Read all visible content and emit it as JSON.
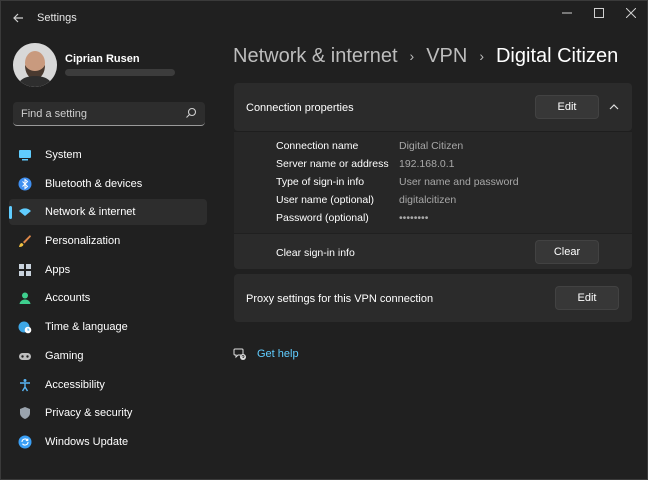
{
  "window": {
    "title": "Settings",
    "controls": [
      "minimize",
      "maximize",
      "close"
    ]
  },
  "profile": {
    "name": "Ciprian Rusen"
  },
  "search": {
    "placeholder": "Find a setting"
  },
  "sidebar": {
    "items": [
      {
        "label": "System",
        "icon": "system-icon",
        "color": "#60cdff"
      },
      {
        "label": "Bluetooth & devices",
        "icon": "bluetooth-icon",
        "color": "#3f8ff0"
      },
      {
        "label": "Network & internet",
        "icon": "wifi-icon",
        "color": "#60cdff",
        "active": true
      },
      {
        "label": "Personalization",
        "icon": "brush-icon",
        "color": "#e0894a"
      },
      {
        "label": "Apps",
        "icon": "apps-icon",
        "color": "#c9d3dd"
      },
      {
        "label": "Accounts",
        "icon": "accounts-icon",
        "color": "#3ecf8e"
      },
      {
        "label": "Time & language",
        "icon": "globe-clock-icon",
        "color": "#3ea7e6"
      },
      {
        "label": "Gaming",
        "icon": "gamepad-icon",
        "color": "#bdbdbd"
      },
      {
        "label": "Accessibility",
        "icon": "accessibility-icon",
        "color": "#58b6f5"
      },
      {
        "label": "Privacy & security",
        "icon": "shield-icon",
        "color": "#9aa3ad"
      },
      {
        "label": "Windows Update",
        "icon": "update-icon",
        "color": "#3a9ff5"
      }
    ]
  },
  "breadcrumb": {
    "parts": [
      "Network & internet",
      "VPN"
    ],
    "current": "Digital Citizen",
    "separator": "›"
  },
  "connection": {
    "title": "Connection properties",
    "edit_label": "Edit",
    "properties": [
      {
        "label": "Connection name",
        "value": "Digital Citizen"
      },
      {
        "label": "Server name or address",
        "value": "192.168.0.1"
      },
      {
        "label": "Type of sign-in info",
        "value": "User name and password"
      },
      {
        "label": "User name (optional)",
        "value": "digitalcitizen"
      },
      {
        "label": "Password (optional)",
        "value": "••••••••"
      }
    ],
    "clear_label": "Clear sign-in info",
    "clear_button": "Clear"
  },
  "proxy": {
    "title": "Proxy settings for this VPN connection",
    "edit_label": "Edit"
  },
  "help": {
    "label": "Get help"
  },
  "colors": {
    "accent": "#60cdff",
    "background": "#202020",
    "card": "#2b2b2b"
  }
}
